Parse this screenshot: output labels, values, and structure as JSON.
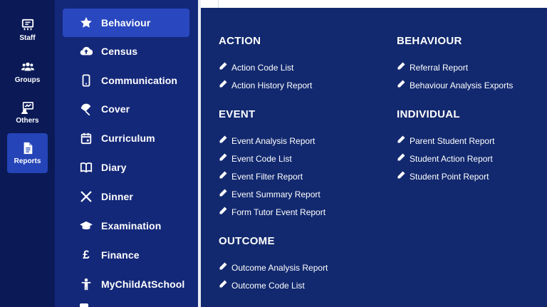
{
  "rail": {
    "items": [
      {
        "label": "Staff",
        "icon": "staff-board-icon",
        "active": false
      },
      {
        "label": "Groups",
        "icon": "users-icon",
        "active": false
      },
      {
        "label": "Others",
        "icon": "chat-board-icon",
        "active": false
      },
      {
        "label": "Reports",
        "icon": "document-icon",
        "active": true
      }
    ]
  },
  "menu": {
    "items": [
      {
        "label": "Behaviour",
        "icon": "star-icon",
        "active": true
      },
      {
        "label": "Census",
        "icon": "cloud-upload-icon",
        "active": false
      },
      {
        "label": "Communication",
        "icon": "mobile-icon",
        "active": false
      },
      {
        "label": "Cover",
        "icon": "umbrella-icon",
        "active": false
      },
      {
        "label": "Curriculum",
        "icon": "calendar-icon",
        "active": false
      },
      {
        "label": "Diary",
        "icon": "book-open-icon",
        "active": false
      },
      {
        "label": "Dinner",
        "icon": "utensils-icon",
        "active": false
      },
      {
        "label": "Examination",
        "icon": "graduation-cap-icon",
        "active": false
      },
      {
        "label": "Finance",
        "icon": "pound-icon",
        "active": false
      },
      {
        "label": "MyChildAtSchool",
        "icon": "child-icon",
        "active": false
      }
    ]
  },
  "panel": {
    "sections": {
      "action": {
        "title": "ACTION",
        "links": [
          "Action Code List",
          "Action History Report"
        ]
      },
      "event": {
        "title": "EVENT",
        "links": [
          "Event Analysis Report",
          "Event Code List",
          "Event Filter Report",
          "Event Summary Report",
          "Form Tutor Event Report"
        ]
      },
      "outcome": {
        "title": "OUTCOME",
        "links": [
          "Outcome Analysis Report",
          "Outcome Code List"
        ]
      },
      "behaviour": {
        "title": "BEHAVIOUR",
        "links": [
          "Referral Report",
          "Behaviour Analysis Exports"
        ]
      },
      "individual": {
        "title": "INDIVIDUAL",
        "links": [
          "Parent Student Report",
          "Student Action Report",
          "Student Point Report"
        ]
      }
    },
    "link_icon": "pencil-icon"
  },
  "colors": {
    "rail_bg": "#0b1a57",
    "menu_bg": "#142879",
    "panel_bg": "#12296f",
    "active_bg": "#2948bf",
    "text": "#ffffff"
  }
}
